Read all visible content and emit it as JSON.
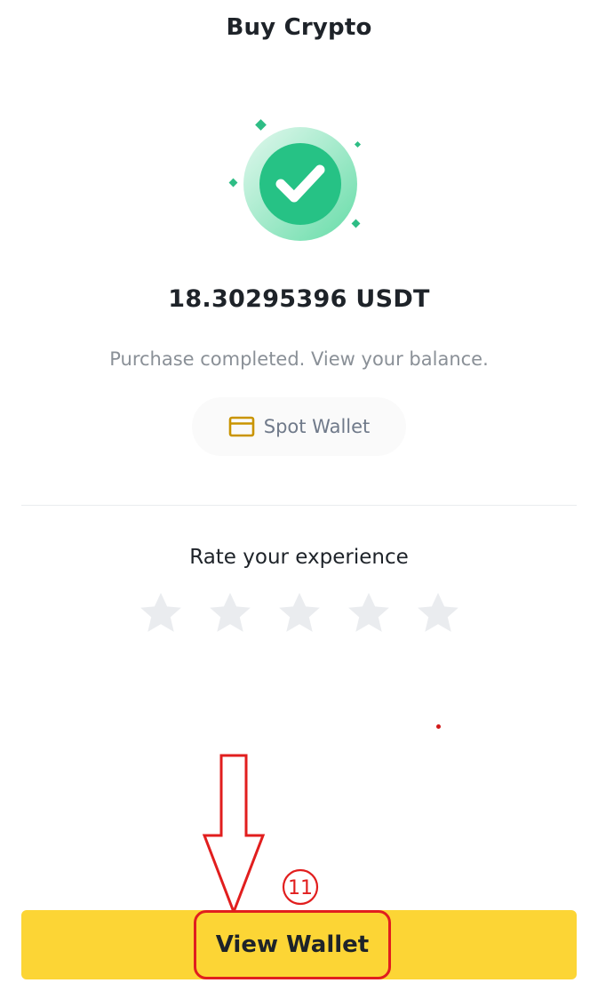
{
  "header": {
    "title": "Buy Crypto"
  },
  "result": {
    "icon": "check-circle-icon",
    "amount": "18.30295396 USDT",
    "message": "Purchase completed. View your balance.",
    "wallet_chip": {
      "icon": "wallet-icon",
      "label": "Spot Wallet"
    }
  },
  "rating": {
    "label": "Rate your experience",
    "max_stars": 5,
    "selected": 0,
    "star_icon": "star-icon"
  },
  "annotation": {
    "step_number": "11",
    "arrow_icon": "down-arrow-icon",
    "highlight_color": "#e11e1e"
  },
  "footer": {
    "primary_button": "View Wallet"
  },
  "colors": {
    "brand_yellow": "#fcd535",
    "success_green": "#2ebd85",
    "wallet_icon": "#c99400",
    "star_inactive": "#eaecef",
    "muted_text": "#8a9097"
  }
}
